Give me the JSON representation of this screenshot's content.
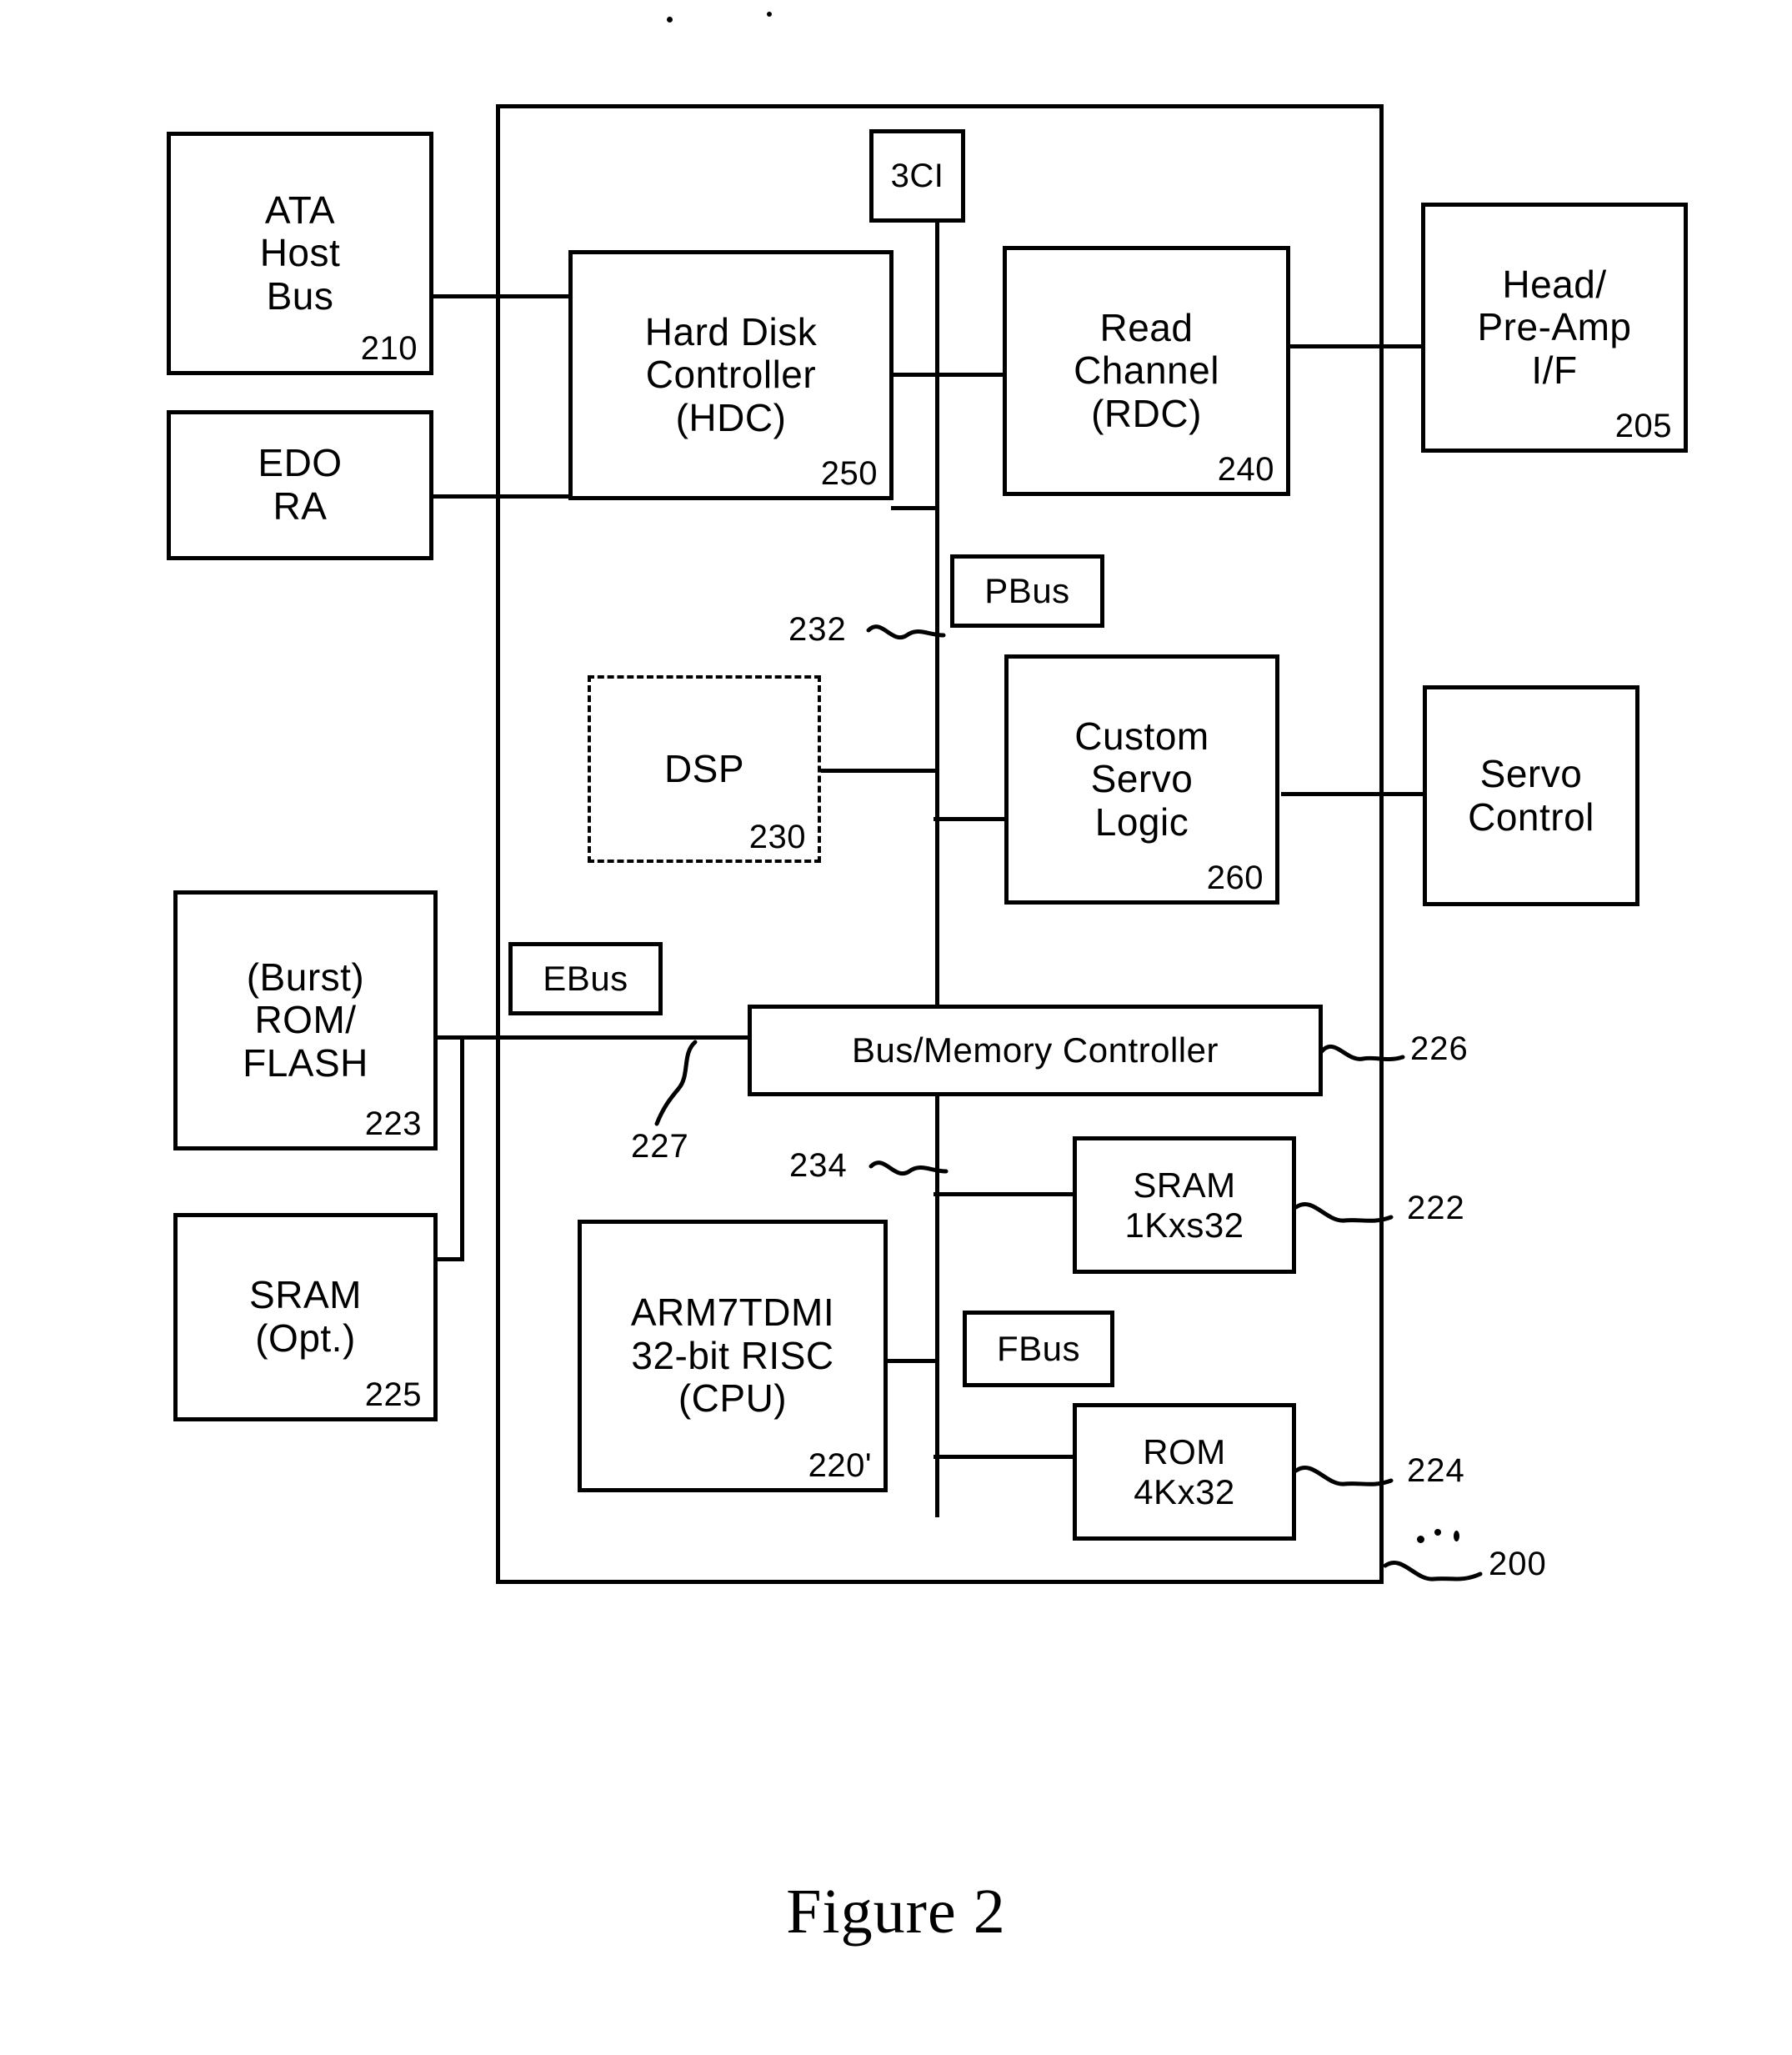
{
  "figure": {
    "caption": "Figure 2",
    "chip_ref": "200"
  },
  "blocks": {
    "ata_host_bus": {
      "label": "ATA\nHost\nBus",
      "ref": "210"
    },
    "edo_ra": {
      "label": "EDO\nRA",
      "ref": ""
    },
    "hdc": {
      "label": "Hard Disk\nController\n(HDC)",
      "ref": "250"
    },
    "three_ci": {
      "label": "3CI",
      "ref": ""
    },
    "rdc": {
      "label": "Read\nChannel\n(RDC)",
      "ref": "240"
    },
    "head_preamp": {
      "label": "Head/\nPre-Amp\nI/F",
      "ref": "205"
    },
    "pbus": {
      "label": "PBus",
      "ref": ""
    },
    "dsp": {
      "label": "DSP",
      "ref": "230"
    },
    "servo_logic": {
      "label": "Custom\nServo\nLogic",
      "ref": "260"
    },
    "servo_control": {
      "label": "Servo\nControl",
      "ref": ""
    },
    "burst_rom": {
      "label": "(Burst)\nROM/\nFLASH",
      "ref": "223"
    },
    "ebus": {
      "label": "EBus",
      "ref": ""
    },
    "bus_mem_ctrl": {
      "label": "Bus/Memory Controller",
      "ref": "226"
    },
    "sram_opt": {
      "label": "SRAM\n(Opt.)",
      "ref": "225"
    },
    "cpu": {
      "label": "ARM7TDMI\n32-bit RISC\n(CPU)",
      "ref": "220'"
    },
    "sram_1k": {
      "label": "SRAM\n1Kxs32",
      "ref": "222"
    },
    "fbus": {
      "label": "FBus",
      "ref": ""
    },
    "rom_4k": {
      "label": "ROM\n4Kx32",
      "ref": "224"
    }
  },
  "bus_refs": {
    "pbus_ref": "232",
    "ebus_ref": "227",
    "fbus_ref": "234"
  },
  "colors": {
    "ink": "#000000",
    "paper": "#ffffff"
  }
}
